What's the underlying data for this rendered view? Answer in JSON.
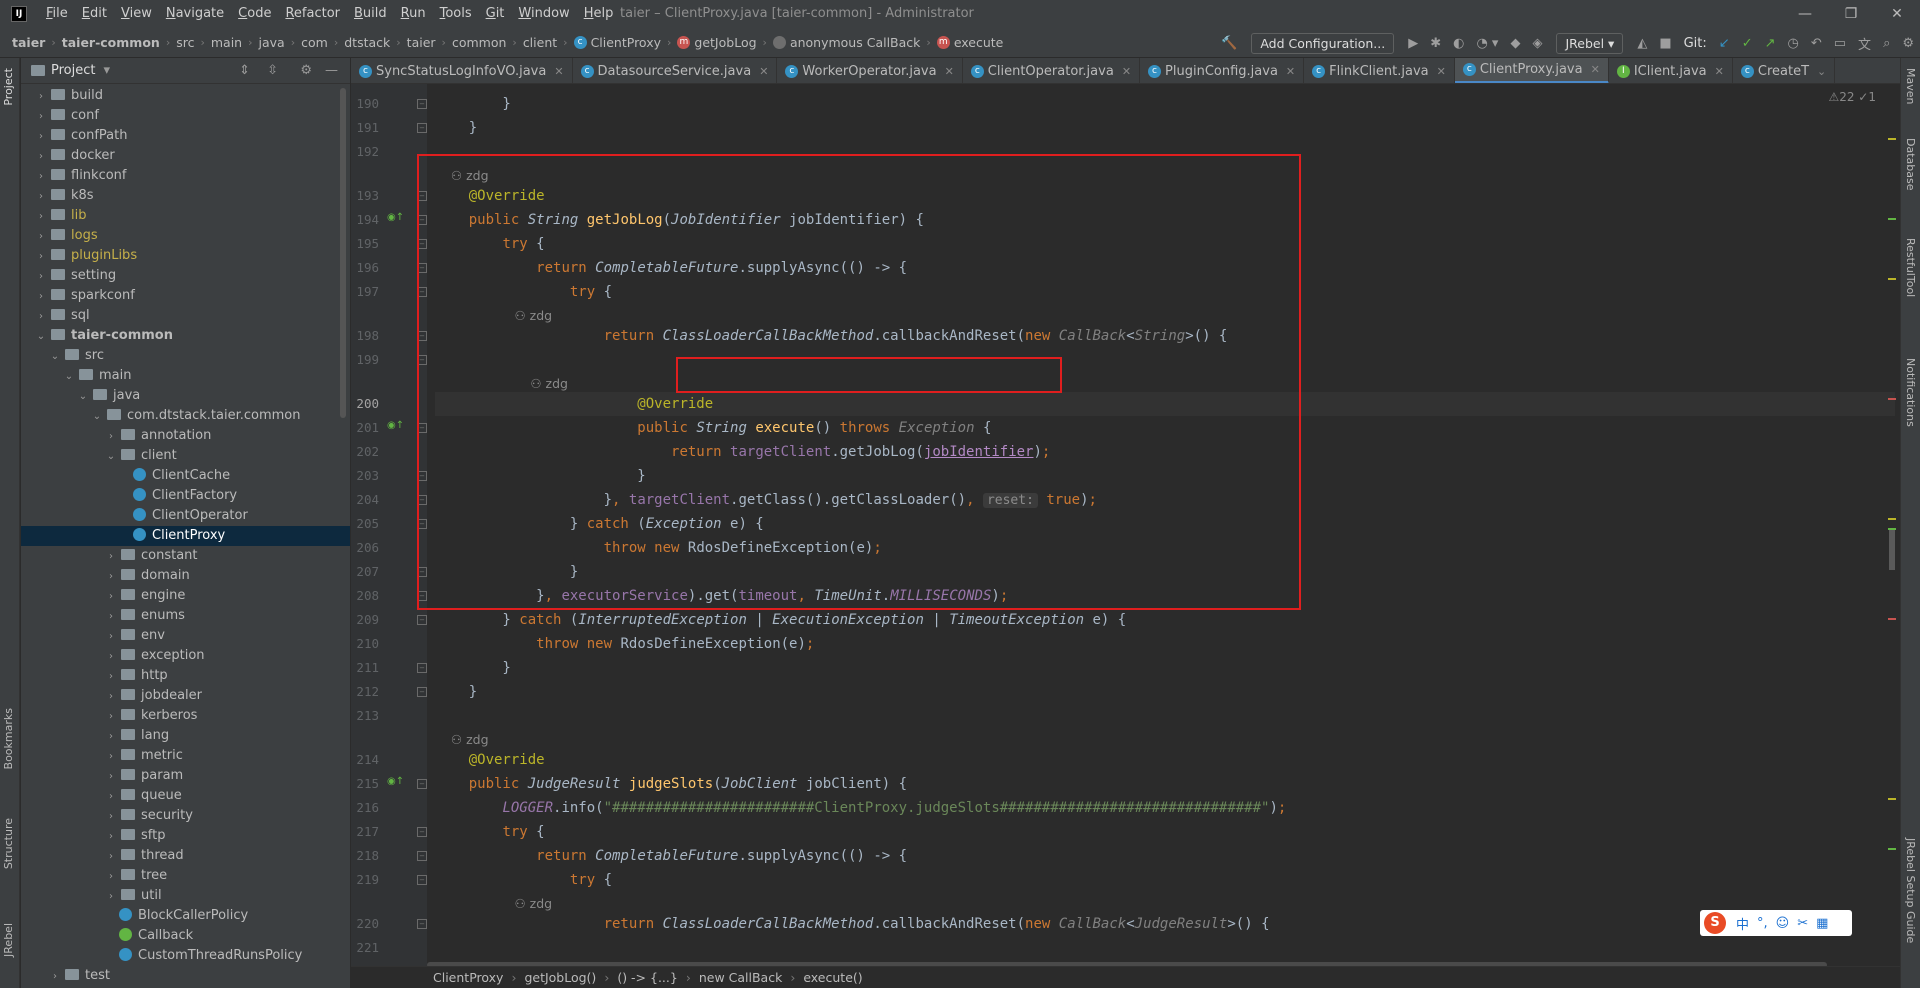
{
  "menubar": {
    "items": [
      "File",
      "Edit",
      "View",
      "Navigate",
      "Code",
      "Refactor",
      "Build",
      "Run",
      "Tools",
      "Git",
      "Window",
      "Help"
    ],
    "title": "taier – ClientProxy.java [taier-common] - Administrator",
    "app_icon": "IJ"
  },
  "nav": {
    "crumbs": [
      "taier",
      "taier-common",
      "src",
      "main",
      "java",
      "com",
      "dtstack",
      "taier",
      "common",
      "client",
      "ClientProxy",
      "getJobLog",
      "anonymous CallBack",
      "execute"
    ],
    "add_config": "Add Configuration...",
    "jrebel": "JRebel",
    "git": "Git:"
  },
  "left_tabs": {
    "project": "Project",
    "bookmarks": "Bookmarks",
    "structure": "Structure",
    "jrebel": "JRebel"
  },
  "right_tabs": {
    "maven": "Maven",
    "database": "Database",
    "restful": "RestfulTool",
    "notifications": "Notifications",
    "jrebel_guide": "JRebel Setup Guide"
  },
  "project": {
    "title": "Project",
    "items": [
      {
        "t": "build",
        "d": 0,
        "k": "folder",
        "a": "›"
      },
      {
        "t": "conf",
        "d": 0,
        "k": "folder",
        "a": "›"
      },
      {
        "t": "confPath",
        "d": 0,
        "k": "folder",
        "a": "›"
      },
      {
        "t": "docker",
        "d": 0,
        "k": "folder",
        "a": "›"
      },
      {
        "t": "flinkconf",
        "d": 0,
        "k": "folder",
        "a": "›"
      },
      {
        "t": "k8s",
        "d": 0,
        "k": "folder",
        "a": "›"
      },
      {
        "t": "lib",
        "d": 0,
        "k": "folder",
        "a": "›",
        "y": true
      },
      {
        "t": "logs",
        "d": 0,
        "k": "folder",
        "a": "›",
        "y": true
      },
      {
        "t": "pluginLibs",
        "d": 0,
        "k": "folder",
        "a": "›",
        "y": true
      },
      {
        "t": "setting",
        "d": 0,
        "k": "folder",
        "a": "›"
      },
      {
        "t": "sparkconf",
        "d": 0,
        "k": "folder",
        "a": "›"
      },
      {
        "t": "sql",
        "d": 0,
        "k": "folder",
        "a": "›"
      },
      {
        "t": "taier-common",
        "d": 0,
        "k": "folder",
        "a": "⌄",
        "b": true
      },
      {
        "t": "src",
        "d": 1,
        "k": "folder",
        "a": "⌄"
      },
      {
        "t": "main",
        "d": 2,
        "k": "folder",
        "a": "⌄"
      },
      {
        "t": "java",
        "d": 3,
        "k": "folder",
        "a": "⌄"
      },
      {
        "t": "com.dtstack.taier.common",
        "d": 4,
        "k": "folder",
        "a": "⌄"
      },
      {
        "t": "annotation",
        "d": 5,
        "k": "folder",
        "a": "›"
      },
      {
        "t": "client",
        "d": 5,
        "k": "folder",
        "a": "⌄"
      },
      {
        "t": "ClientCache",
        "d": 6,
        "k": "class"
      },
      {
        "t": "ClientFactory",
        "d": 6,
        "k": "class"
      },
      {
        "t": "ClientOperator",
        "d": 6,
        "k": "class"
      },
      {
        "t": "ClientProxy",
        "d": 6,
        "k": "class",
        "sel": true
      },
      {
        "t": "constant",
        "d": 5,
        "k": "folder",
        "a": "›"
      },
      {
        "t": "domain",
        "d": 5,
        "k": "folder",
        "a": "›"
      },
      {
        "t": "engine",
        "d": 5,
        "k": "folder",
        "a": "›"
      },
      {
        "t": "enums",
        "d": 5,
        "k": "folder",
        "a": "›"
      },
      {
        "t": "env",
        "d": 5,
        "k": "folder",
        "a": "›"
      },
      {
        "t": "exception",
        "d": 5,
        "k": "folder",
        "a": "›"
      },
      {
        "t": "http",
        "d": 5,
        "k": "folder",
        "a": "›"
      },
      {
        "t": "jobdealer",
        "d": 5,
        "k": "folder",
        "a": "›"
      },
      {
        "t": "kerberos",
        "d": 5,
        "k": "folder",
        "a": "›"
      },
      {
        "t": "lang",
        "d": 5,
        "k": "folder",
        "a": "›"
      },
      {
        "t": "metric",
        "d": 5,
        "k": "folder",
        "a": "›"
      },
      {
        "t": "param",
        "d": 5,
        "k": "folder",
        "a": "›"
      },
      {
        "t": "queue",
        "d": 5,
        "k": "folder",
        "a": "›"
      },
      {
        "t": "security",
        "d": 5,
        "k": "folder",
        "a": "›"
      },
      {
        "t": "sftp",
        "d": 5,
        "k": "folder",
        "a": "›"
      },
      {
        "t": "thread",
        "d": 5,
        "k": "folder",
        "a": "›"
      },
      {
        "t": "tree",
        "d": 5,
        "k": "folder",
        "a": "›"
      },
      {
        "t": "util",
        "d": 5,
        "k": "folder",
        "a": "›"
      },
      {
        "t": "BlockCallerPolicy",
        "d": 5,
        "k": "class"
      },
      {
        "t": "Callback",
        "d": 5,
        "k": "iface"
      },
      {
        "t": "CustomThreadRunsPolicy",
        "d": 5,
        "k": "class"
      },
      {
        "t": "test",
        "d": 1,
        "k": "folder",
        "a": "›"
      }
    ]
  },
  "tabs": [
    "SyncStatusLogInfoVO.java",
    "DatasourceService.java",
    "WorkerOperator.java",
    "ClientOperator.java",
    "PluginConfig.java",
    "FlinkClient.java",
    "ClientProxy.java",
    "IClient.java",
    "CreateT"
  ],
  "active_tab": "ClientProxy.java",
  "inspection": "⚠22 ✓1",
  "breadcrumb_bottom": [
    "ClientProxy",
    "getJobLog()",
    "() -> {...}",
    "new CallBack",
    "execute()"
  ],
  "ime": {
    "logo": "S",
    "items": [
      "中",
      "°,",
      "☺",
      "✂",
      "▦"
    ]
  },
  "author": "zdg",
  "lines": [
    {
      "n": "190",
      "c": "        }"
    },
    {
      "n": "191",
      "c": "    }"
    },
    {
      "n": "192",
      "c": ""
    },
    {
      "n": "",
      "h": "    👤 zdg"
    },
    {
      "n": "193",
      "c": "    @Override"
    },
    {
      "n": "194",
      "c": "    public String getJobLog(JobIdentifier jobIdentifier) {"
    },
    {
      "n": "195",
      "c": "        try {"
    },
    {
      "n": "196",
      "c": "            return CompletableFuture.supplyAsync(() -> {"
    },
    {
      "n": "197",
      "c": "                try {"
    },
    {
      "n": "",
      "h": "                    👤 zdg"
    },
    {
      "n": "198",
      "c": "                    return ClassLoaderCallBackMethod.callbackAndReset(new CallBack<String>() {"
    },
    {
      "n": "199",
      "c": ""
    },
    {
      "n": "",
      "h": "                        👤 zdg"
    },
    {
      "n": "200",
      "c": "                        @Override"
    },
    {
      "n": "201",
      "c": "                        public String execute() throws Exception {"
    },
    {
      "n": "202",
      "c": "                            return targetClient.getJobLog(jobIdentifier);"
    },
    {
      "n": "203",
      "c": "                        }"
    },
    {
      "n": "204",
      "c": "                    }, targetClient.getClass().getClassLoader(), reset: true);"
    },
    {
      "n": "205",
      "c": "                } catch (Exception e) {"
    },
    {
      "n": "206",
      "c": "                    throw new RdosDefineException(e);"
    },
    {
      "n": "207",
      "c": "                }"
    },
    {
      "n": "208",
      "c": "            }, executorService).get(timeout, TimeUnit.MILLISECONDS);"
    },
    {
      "n": "209",
      "c": "        } catch (InterruptedException | ExecutionException | TimeoutException e) {"
    },
    {
      "n": "210",
      "c": "            throw new RdosDefineException(e);"
    },
    {
      "n": "211",
      "c": "        }"
    },
    {
      "n": "212",
      "c": "    }"
    },
    {
      "n": "213",
      "c": ""
    },
    {
      "n": "",
      "h": "    👤 zdg"
    },
    {
      "n": "214",
      "c": "    @Override"
    },
    {
      "n": "215",
      "c": "    public JudgeResult judgeSlots(JobClient jobClient) {"
    },
    {
      "n": "216",
      "c": "        LOGGER.info(\"########################ClientProxy.judgeSlots###############################\");"
    },
    {
      "n": "217",
      "c": "        try {"
    },
    {
      "n": "218",
      "c": "            return CompletableFuture.supplyAsync(() -> {"
    },
    {
      "n": "219",
      "c": "                try {"
    },
    {
      "n": "",
      "h": "                    👤 zdg"
    },
    {
      "n": "220",
      "c": "                    return ClassLoaderCallBackMethod.callbackAndReset(new CallBack<JudgeResult>() {"
    },
    {
      "n": "221",
      "c": ""
    }
  ]
}
